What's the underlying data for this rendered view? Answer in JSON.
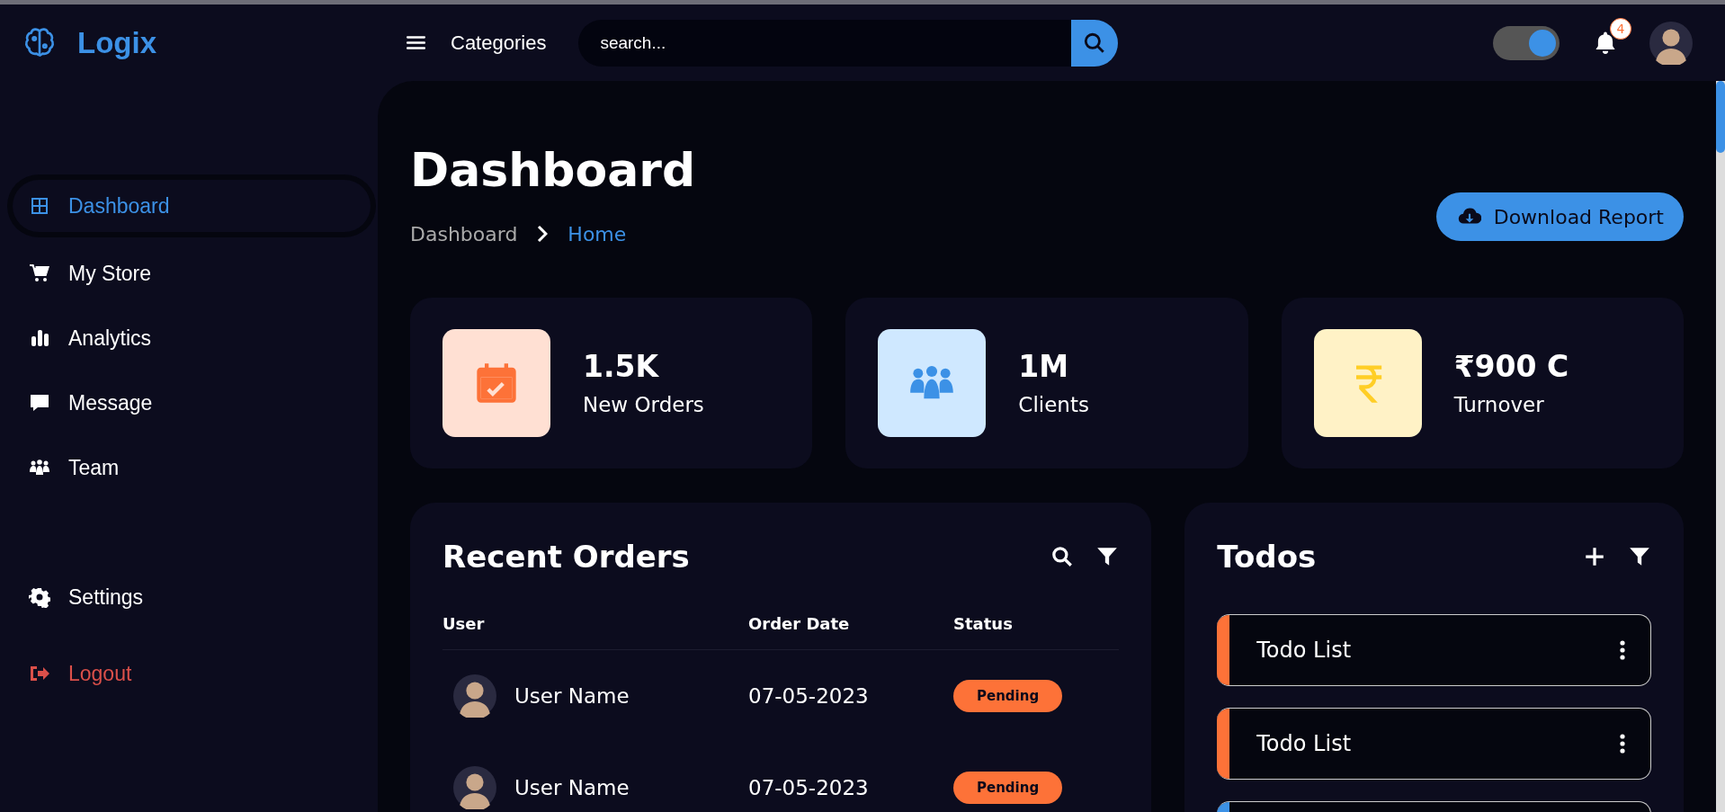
{
  "brand": {
    "name": "Logix"
  },
  "topbar": {
    "categories": "Categories",
    "search": {
      "placeholder": "search..."
    },
    "theme_toggle": {
      "on": true
    },
    "notifications": {
      "count": "4"
    }
  },
  "sidebar": {
    "items": [
      {
        "label": "Dashboard",
        "kind": "grid",
        "selected": true
      },
      {
        "label": "My Store",
        "kind": "cart",
        "selected": false
      },
      {
        "label": "Analytics",
        "kind": "bars",
        "selected": false
      },
      {
        "label": "Message",
        "kind": "chat",
        "selected": false
      },
      {
        "label": "Team",
        "kind": "team",
        "selected": false
      }
    ],
    "bottom_items": [
      {
        "label": "Settings",
        "kind": "normal"
      },
      {
        "label": "Logout",
        "kind": "danger"
      }
    ]
  },
  "header": {
    "title": "Dashboard",
    "breadcrumb": [
      {
        "label": "Dashboard",
        "selected": false
      },
      {
        "label": "Home",
        "selected": true
      }
    ],
    "download_button": "Download Report"
  },
  "stats": [
    {
      "value": "1.5K",
      "label": "New Orders",
      "kind": "calendar",
      "color": "#fd7238"
    },
    {
      "value": "1M",
      "label": "Clients",
      "kind": "team",
      "color": "#3c91e6"
    },
    {
      "value": "₹900 C",
      "label": "Turnover",
      "kind": "rupee",
      "color": "#ffce26"
    }
  ],
  "recent_orders": {
    "title": "Recent Orders",
    "columns": [
      "User",
      "Order Date",
      "Status"
    ],
    "rows": [
      {
        "user": "User Name",
        "date": "07-05-2023",
        "status": "Pending"
      },
      {
        "user": "User Name",
        "date": "07-05-2023",
        "status": "Pending"
      }
    ]
  },
  "todos": {
    "title": "Todos",
    "items": [
      {
        "text": "Todo List",
        "color": "#fd7238"
      },
      {
        "text": "Todo List",
        "color": "#fd7238"
      },
      {
        "color": "#3c91e6"
      }
    ]
  }
}
